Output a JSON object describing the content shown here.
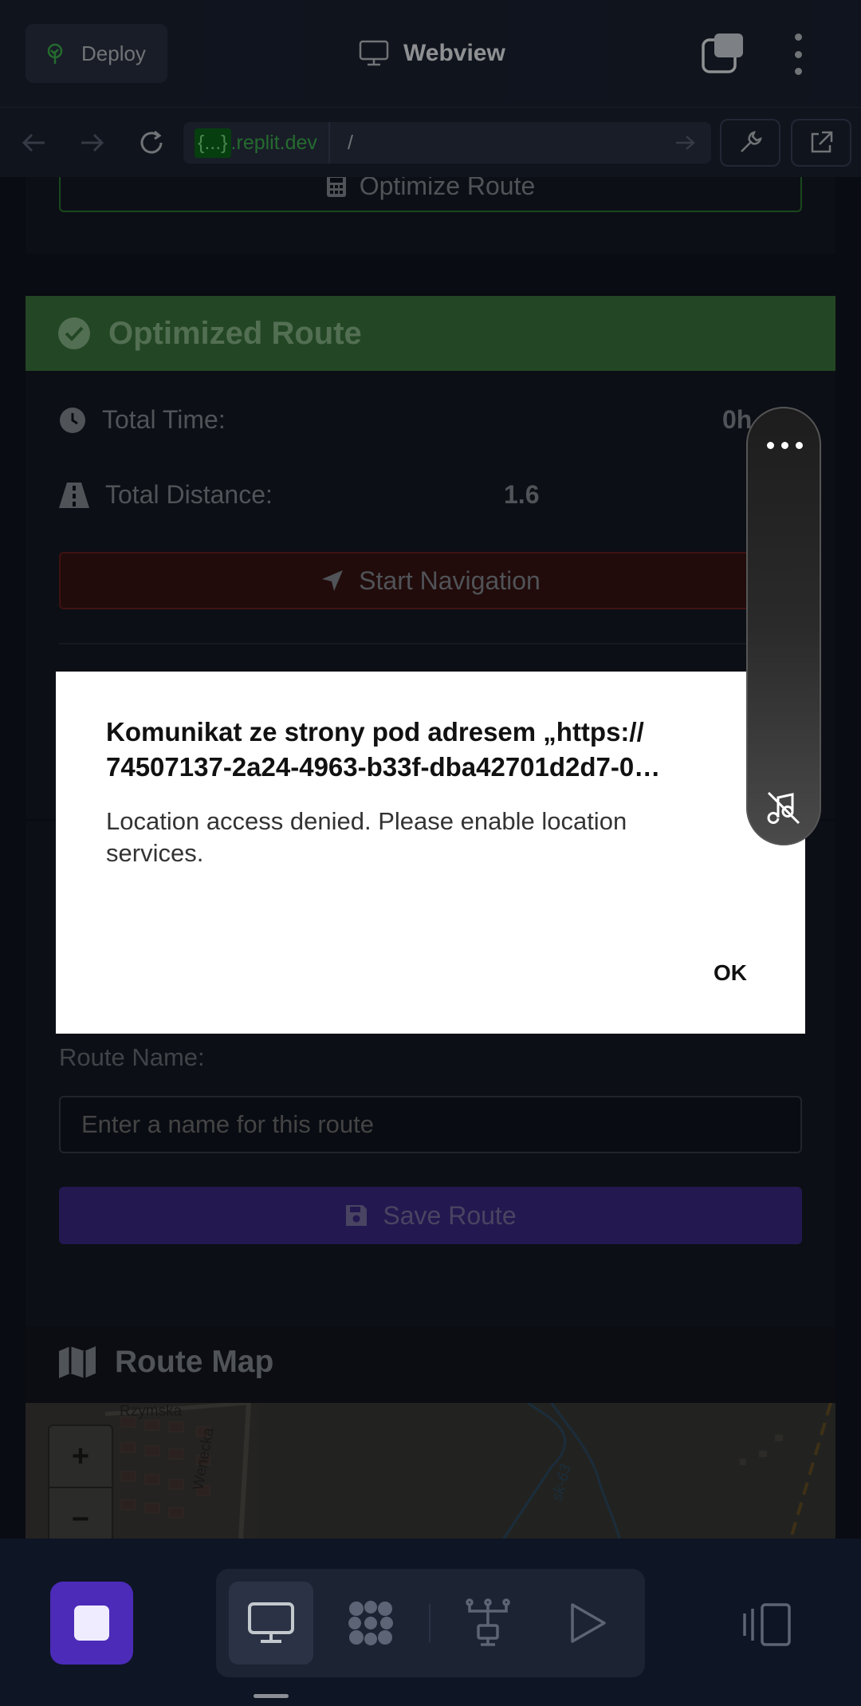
{
  "topbar": {
    "deploy_label": "Deploy",
    "webview_title": "Webview"
  },
  "urlbar": {
    "host_highlight": "{...}",
    "host_suffix": ".replit.dev",
    "path": "/"
  },
  "page": {
    "optimize_button": "Optimize Route",
    "optimized_header": "Optimized Route",
    "total_time_label": "Total Time:",
    "total_time_value": "0h",
    "total_distance_label": "Total Distance:",
    "total_distance_value": "1.6",
    "start_navigation": "Start Navigation",
    "route_name_label": "Route Name:",
    "route_name_placeholder": "Enter a name for this route",
    "save_route": "Save Route",
    "route_map_title": "Route Map",
    "map_labels": {
      "street1": "Rzymska",
      "street2": "Wenecka",
      "road": "sk-63"
    },
    "zoom_in": "+",
    "zoom_out": "−"
  },
  "dialog": {
    "title_line1": "Komunikat ze strony pod adresem „https://",
    "title_line2": "74507137-2a24-4963-b33f-dba42701d2d7-0…",
    "message": "Location access denied. Please enable location services.",
    "ok_label": "OK"
  },
  "colors": {
    "accent_purple": "#4b2bb8",
    "success_green": "#3d7a3f",
    "danger_red": "#6d1f1f"
  }
}
